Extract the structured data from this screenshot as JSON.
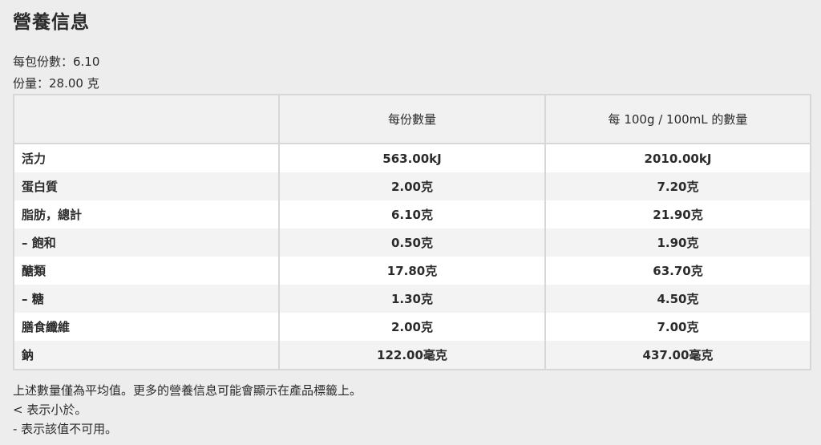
{
  "title": "營養信息",
  "servings_line": "每包份數：6.10",
  "serving_size_line": "份量：28.00 克",
  "table": {
    "headers": [
      "",
      "每份數量",
      "每 100g / 100mL 的數量"
    ],
    "rows": [
      {
        "name": "活力",
        "per_serving": "563.00kJ",
        "per_100": "2010.00kJ"
      },
      {
        "name": "蛋白質",
        "per_serving": "2.00克",
        "per_100": "7.20克"
      },
      {
        "name": "脂肪，總計",
        "per_serving": "6.10克",
        "per_100": "21.90克"
      },
      {
        "name": "– 飽和",
        "per_serving": "0.50克",
        "per_100": "1.90克"
      },
      {
        "name": "醣類",
        "per_serving": "17.80克",
        "per_100": "63.70克"
      },
      {
        "name": "– 糖",
        "per_serving": "1.30克",
        "per_100": "4.50克"
      },
      {
        "name": "膳食纖維",
        "per_serving": "2.00克",
        "per_100": "7.00克"
      },
      {
        "name": "鈉",
        "per_serving": "122.00毫克",
        "per_100": "437.00毫克"
      }
    ]
  },
  "notes": [
    "上述數量僅為平均值。更多的營養信息可能會顯示在產品標籤上。",
    "< 表示小於。",
    "- 表示該值不可用。"
  ]
}
